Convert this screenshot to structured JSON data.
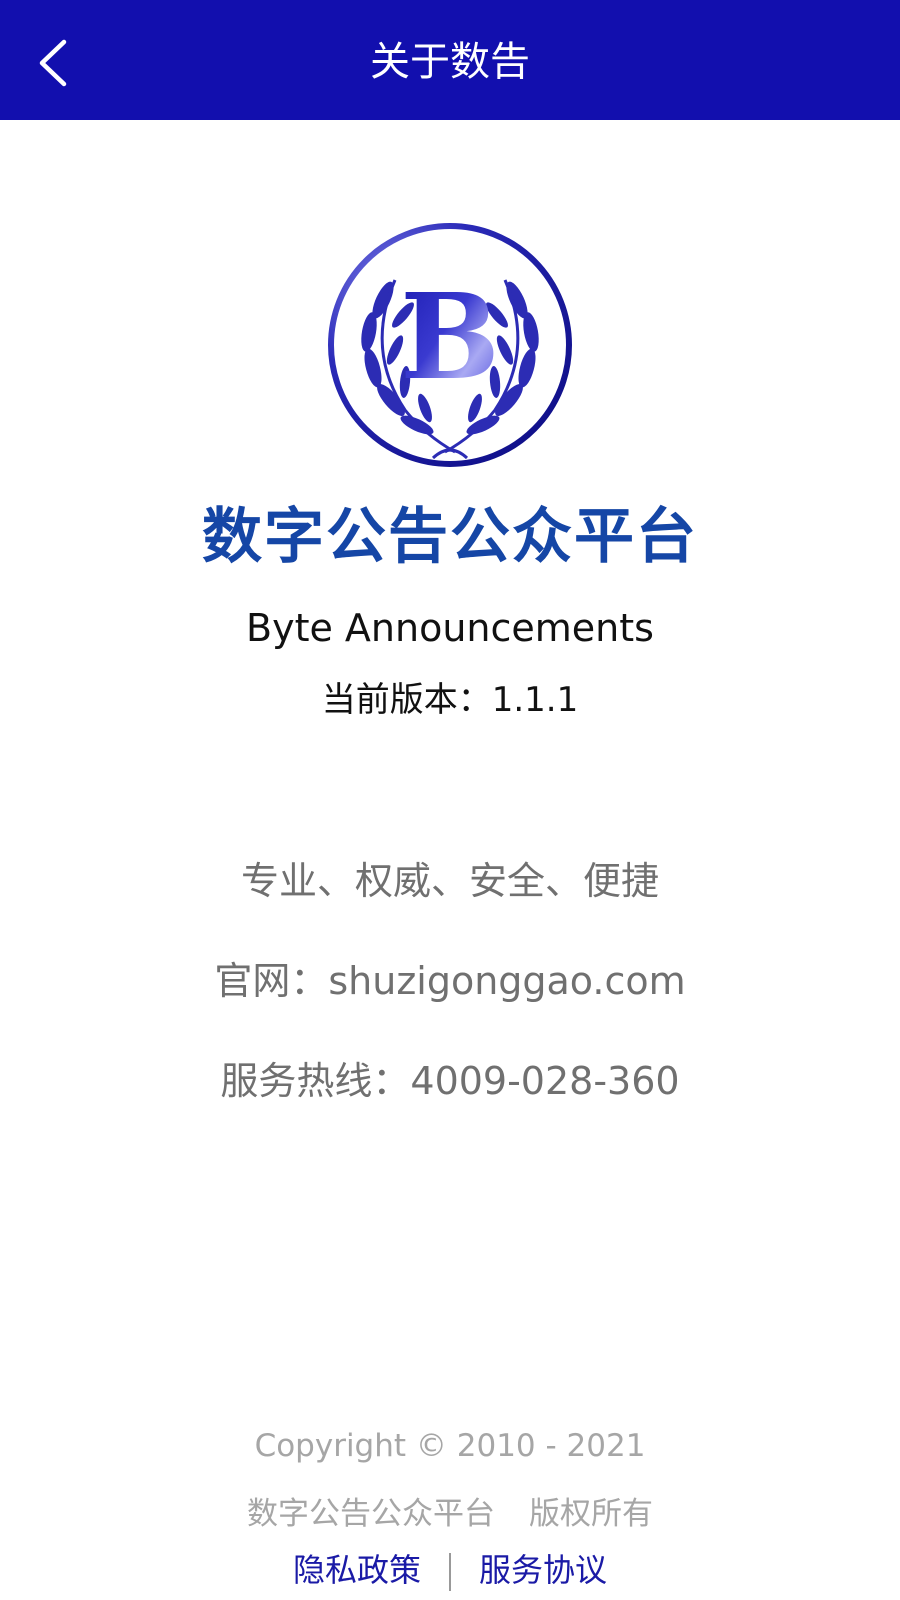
{
  "header": {
    "title": "关于数告",
    "back_icon": "chevron-left-icon",
    "background_color": "#120fae"
  },
  "logo": {
    "icon": "laurel-b-logo",
    "letter": "B"
  },
  "app": {
    "name_zh": "数字公告公众平台",
    "name_en": "Byte Announcements",
    "version_label": "当前版本：",
    "version": "1.1.1"
  },
  "info": {
    "slogan": "专业、权威、安全、便捷",
    "website": "官网：shuzigonggao.com",
    "hotline": "服务热线：4009-028-360"
  },
  "footer": {
    "copyright": "Copyright © 2010 - 2021",
    "owner": "数字公告公众平台",
    "rights": "版权所有",
    "privacy_link": "隐私政策",
    "terms_link": "服务协议"
  },
  "colors": {
    "brand_blue": "#1546a6",
    "link_blue": "#1a1aa6"
  }
}
